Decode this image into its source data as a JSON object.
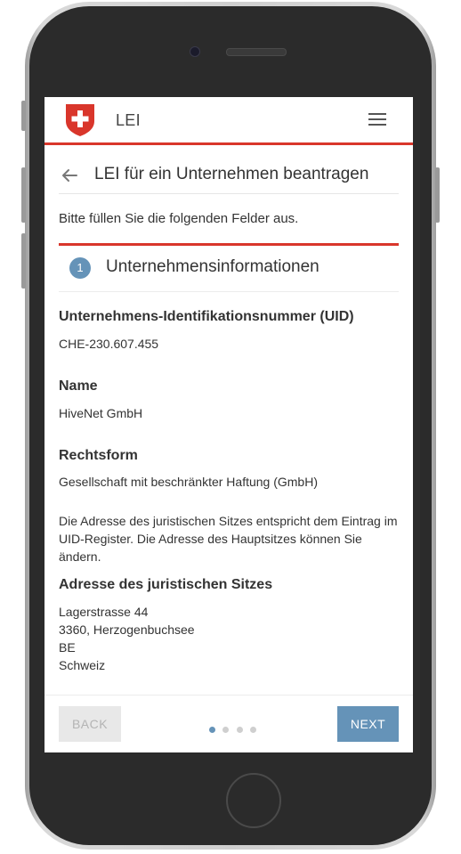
{
  "app": {
    "title": "LEI"
  },
  "header": {
    "title": "LEI für ein Unternehmen beantragen"
  },
  "intro": "Bitte füllen Sie die folgenden Felder aus.",
  "step": {
    "number": "1",
    "title": "Unternehmensinformationen"
  },
  "fields": {
    "uid": {
      "label": "Unternehmens-Identifikationsnummer (UID)",
      "value": "CHE-230.607.455"
    },
    "name": {
      "label": "Name",
      "value": "HiveNet GmbH"
    },
    "legal_form": {
      "label": "Rechtsform",
      "value": "Gesellschaft mit beschränkter Haftung (GmbH)"
    }
  },
  "note": "Die Adresse des juristischen Sitzes entspricht dem Eintrag im UID-Register. Die Adresse des Hauptsitzes können Sie ändern.",
  "address": {
    "label": "Adresse des juristischen Sitzes",
    "street": "Lagerstrasse 44",
    "city": "3360, Herzogenbuchsee",
    "canton": "BE",
    "country": "Schweiz"
  },
  "footer": {
    "back_label": "BACK",
    "next_label": "NEXT",
    "steps_total": 4,
    "steps_current": 1
  },
  "colors": {
    "accent_red": "#d9362b",
    "primary_blue": "#6593b8"
  },
  "icons": {
    "logo": "swiss-cross-shield-icon",
    "menu": "hamburger-menu-icon",
    "back": "arrow-left-icon"
  }
}
